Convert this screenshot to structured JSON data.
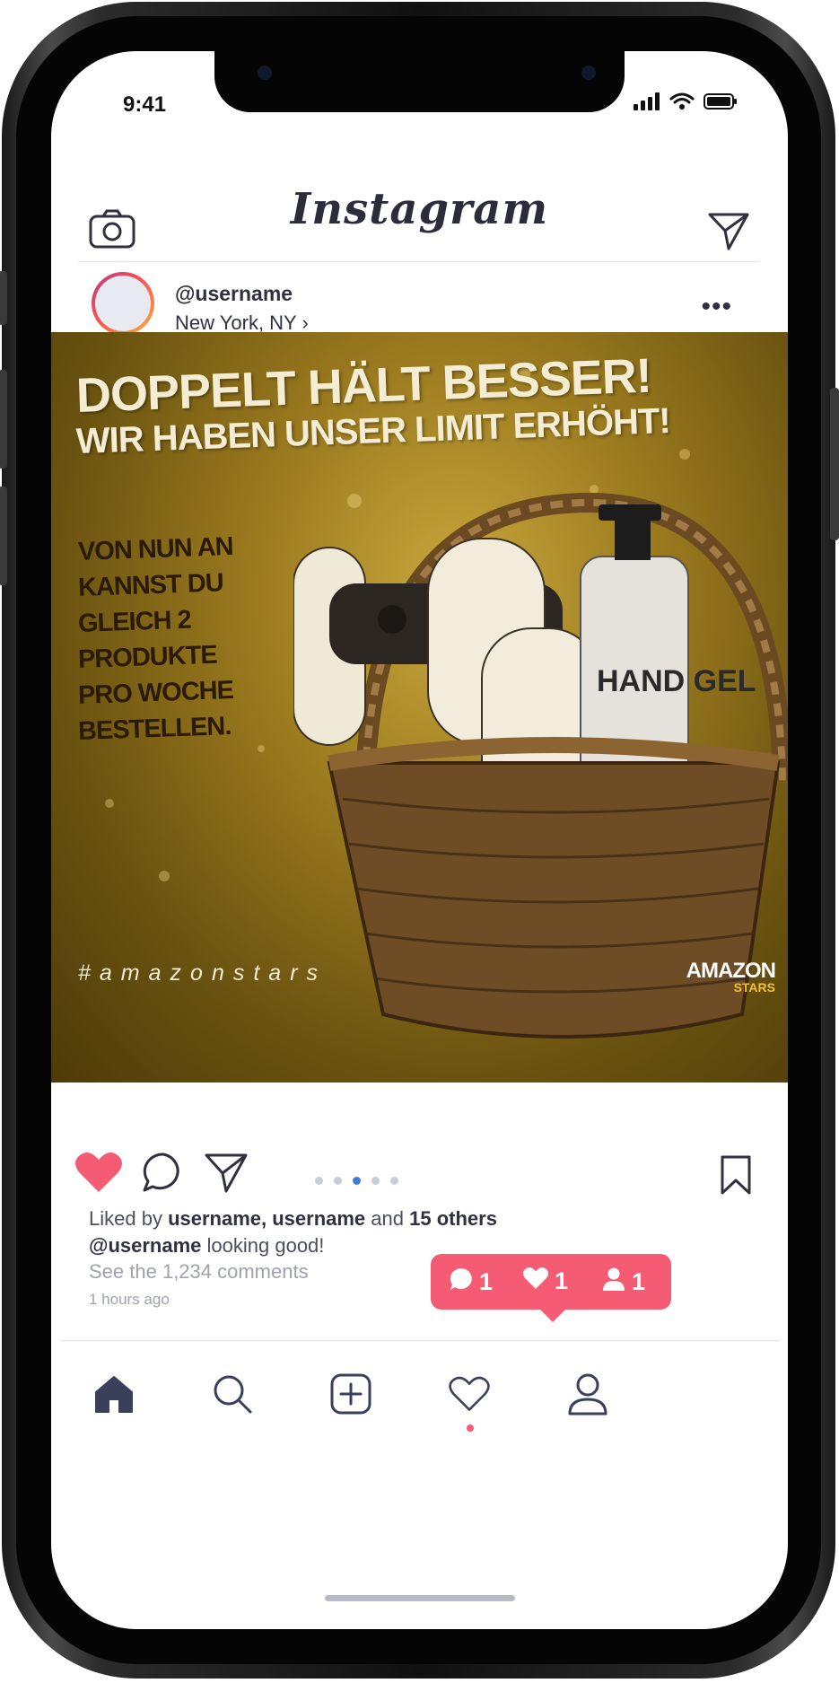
{
  "status_bar": {
    "time": "9:41"
  },
  "app": {
    "title": "Instagram"
  },
  "post": {
    "username": "@username",
    "location": "New York, NY ›",
    "menu": "•••",
    "image": {
      "headline_1": "DOPPELT HÄLT BESSER!",
      "headline_2": "WIR HABEN UNSER LIMIT ERHÖHT!",
      "body_lines": [
        "VON NUN AN",
        "KANNST DU",
        "GLEICH 2",
        "PRODUKTE",
        "PRO WOCHE",
        "BESTELLEN."
      ],
      "hashtag": "#amazonstars",
      "brand_line1": "AMAZON",
      "brand_line2": "STARS",
      "product_label": "HAND GEL"
    },
    "carousel": {
      "count": 5,
      "active_index": 2
    },
    "likes": {
      "prefix": "Liked by ",
      "users": "username, username",
      "middle": " and ",
      "others": "15 others"
    },
    "caption": {
      "user": "@username",
      "text": " looking good!"
    },
    "comments_link": "See the 1,234 comments",
    "time_ago": "1 hours ago"
  },
  "notification": {
    "comments": "1",
    "likes": "1",
    "follows": "1"
  },
  "colors": {
    "like": "#f55b72",
    "accent": "#3f7ae0",
    "text_dark": "#2f3140",
    "muted": "#9ea2ae"
  },
  "tabs": [
    "home-icon",
    "search-icon",
    "add-icon",
    "heart-icon",
    "profile-icon"
  ]
}
